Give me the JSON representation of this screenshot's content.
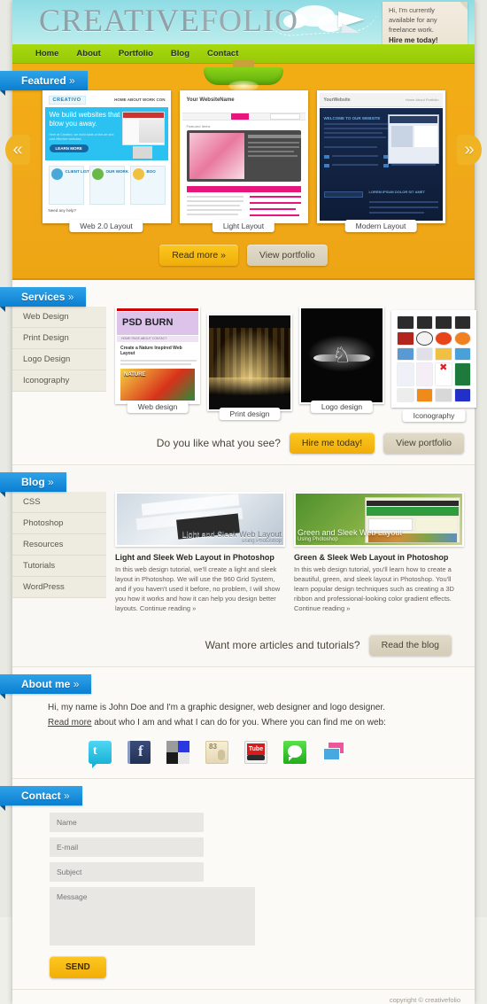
{
  "site": {
    "logo_primary": "CREATIVE",
    "logo_secondary": "FOLIO",
    "footer": "copyright © creativefolio"
  },
  "colors": {
    "accent_blue": "#0b7fd1",
    "nav_green": "#a6d90d",
    "featured_gold": "#f0a81a",
    "sky": "#a9e6ea",
    "beige": "#eeebe1"
  },
  "note": {
    "line1": "Hi, I'm currently",
    "line2": "available for any",
    "line3": "freelance work.",
    "cta": "Hire me today!"
  },
  "nav": {
    "items": [
      {
        "label": "Home"
      },
      {
        "label": "About"
      },
      {
        "label": "Portfolio"
      },
      {
        "label": "Blog"
      },
      {
        "label": "Contact"
      }
    ]
  },
  "featured": {
    "title": "Featured",
    "chev": "»",
    "prev_icon": "«",
    "next_icon": "»",
    "slides": [
      {
        "caption": "Web 2.0 Layout",
        "headline": "We build websites that blow you away.",
        "brand": "CREATIVO",
        "menu": "HOME  ABOUT  WORK  CON",
        "cta": "LEARN MORE"
      },
      {
        "caption": "Light Layout",
        "brand": "Your WebsiteName",
        "section": "Featured Items"
      },
      {
        "caption": "Modern Layout",
        "brand": "YourWebsite",
        "section": "WELCOME TO OUR WEBSITE"
      }
    ],
    "buttons": {
      "read_more": "Read more »",
      "view_portfolio": "View portfolio"
    }
  },
  "services": {
    "title": "Services",
    "chev": "»",
    "menu": [
      {
        "label": "Web Design"
      },
      {
        "label": "Print Design"
      },
      {
        "label": "Logo Design"
      },
      {
        "label": "Iconography"
      }
    ],
    "items": [
      {
        "caption": "Web design",
        "thumb_title": "PSD BURN",
        "thumb_sub": "Create a Nature Inspired Web Layout"
      },
      {
        "caption": "Print design",
        "thumb_title": ""
      },
      {
        "caption": "Logo design",
        "thumb_title": ""
      },
      {
        "caption": "Iconography",
        "thumb_title": ""
      }
    ],
    "cta_question": "Do you like what you see?",
    "cta_primary": "Hire me today!",
    "cta_secondary": "View portfolio"
  },
  "blog": {
    "title": "Blog",
    "chev": "»",
    "categories": [
      {
        "label": "CSS"
      },
      {
        "label": "Photoshop"
      },
      {
        "label": "Resources"
      },
      {
        "label": "Tutorials"
      },
      {
        "label": "WordPress"
      }
    ],
    "posts": [
      {
        "overlay_title": "Light and Sleek Web Layout",
        "overlay_sub": "using Photoshop",
        "title": "Light and Sleek Web Layout in Photoshop",
        "excerpt": "In this web design tutorial, we'll create a light and sleek layout in Photoshop. We will use the 960 Grid System, and if you haven't used it before, no problem, I will show you how it works and how it can help you design better layouts. Continue reading »"
      },
      {
        "overlay_title": "Green and Sleek Web Layout",
        "overlay_sub": "Using Photoshop",
        "title": "Green & Sleek Web Layout in Photoshop",
        "excerpt": "In this web design tutorial, you'll learn how to create a beautiful, green, and sleek layout in Photoshop. You'll learn popular design techniques such as creating a 3D ribbon and professional-looking color gradient effects. Continue reading »"
      }
    ],
    "cta_question": "Want more articles and tutorials?",
    "cta_button": "Read the blog"
  },
  "about": {
    "title": "About me",
    "chev": "»",
    "line1": "Hi, my name is John Doe and I'm a graphic designer, web designer and logo designer.",
    "read_more": "Read more",
    "line2_rest": " about who I am and what I can do for you. Where you can find me on web:",
    "socials": [
      {
        "name": "twitter-icon",
        "glyph": "t",
        "color": "#3ac8e8"
      },
      {
        "name": "facebook-icon",
        "glyph": "f",
        "color": "#2b3b62"
      },
      {
        "name": "flickr-icon",
        "glyph": "",
        "color": "#bdbdbd"
      },
      {
        "name": "delicious-icon",
        "glyph": "83",
        "color": "#efe4c4"
      },
      {
        "name": "youtube-icon",
        "glyph": "Tube",
        "color": "#d81c1c"
      },
      {
        "name": "chat-icon",
        "glyph": "",
        "color": "#3ecb2c"
      },
      {
        "name": "photos-icon",
        "glyph": "",
        "color": "#f0549a"
      }
    ]
  },
  "contact": {
    "title": "Contact",
    "chev": "»",
    "fields": {
      "name_placeholder": "Name",
      "email_placeholder": "E-mail",
      "subject_placeholder": "Subject",
      "message_placeholder": "Message"
    },
    "send_label": "SEND"
  }
}
